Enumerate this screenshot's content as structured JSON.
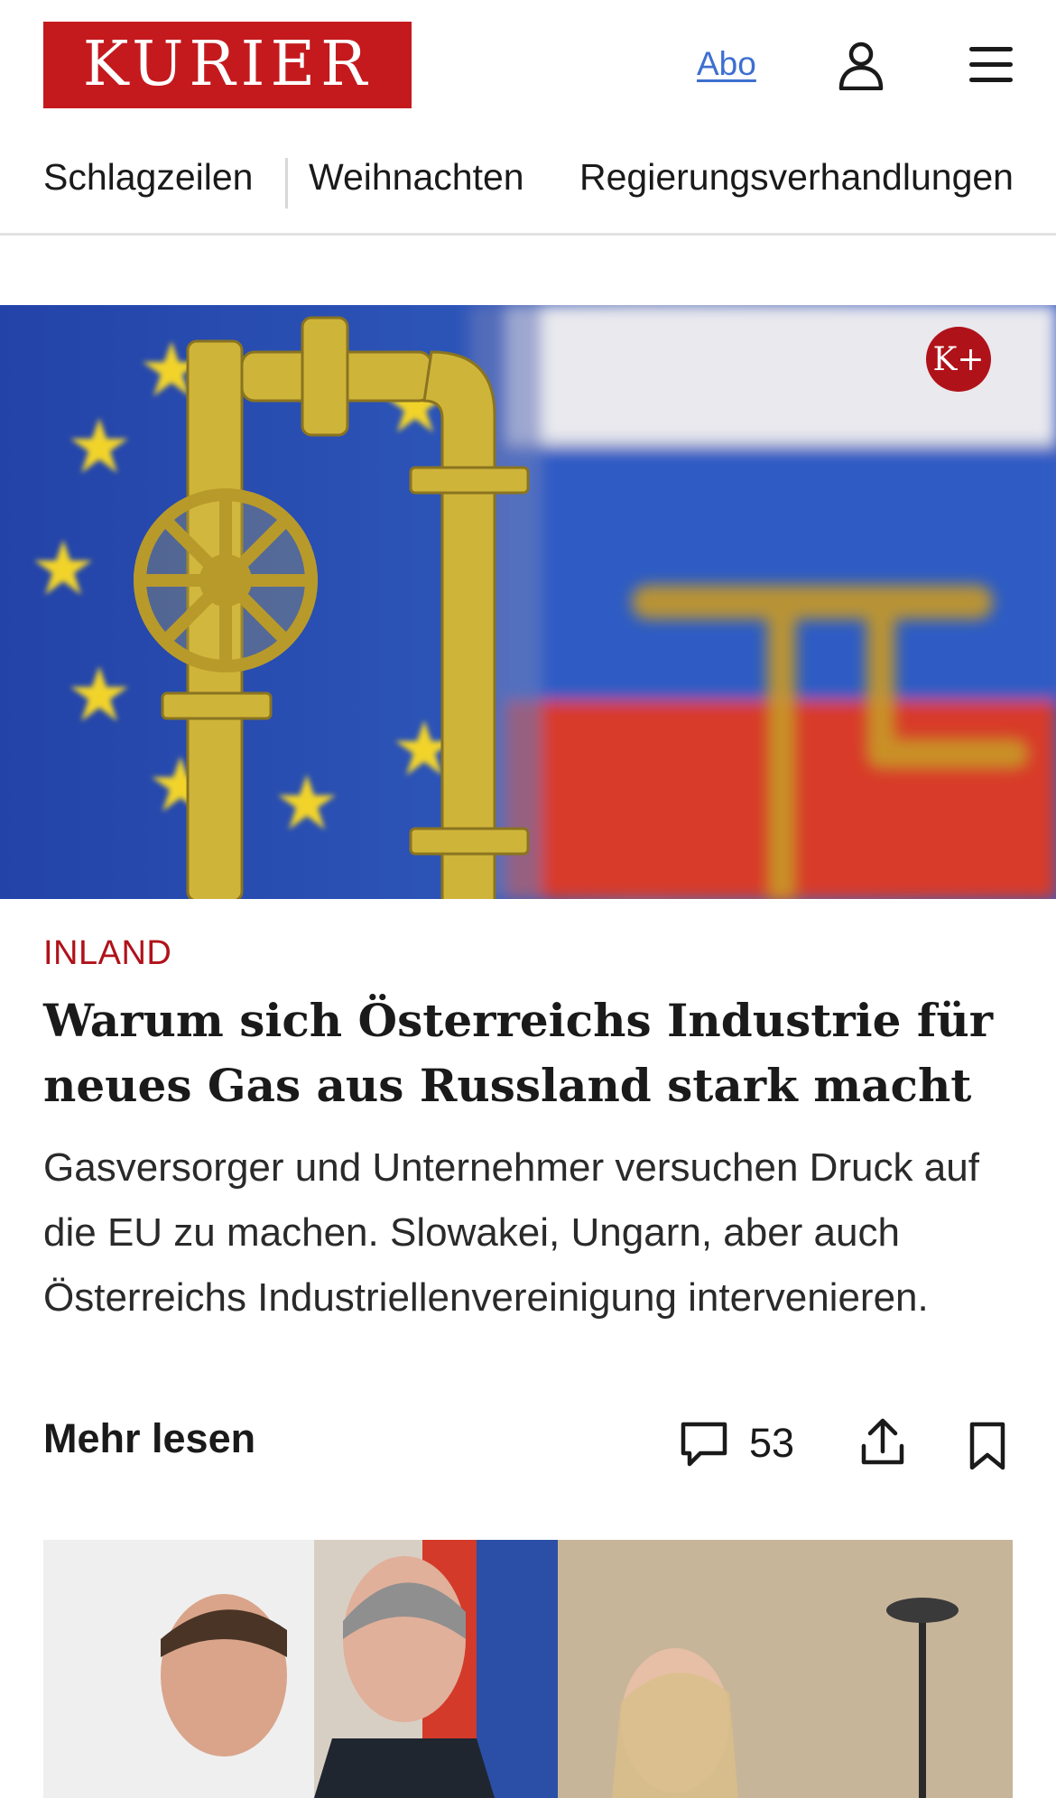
{
  "header": {
    "logo_text": "KURIER",
    "abo_label": "Abo",
    "user_icon": "user-icon",
    "menu_icon": "hamburger-menu-icon",
    "brand_color": "#c41a1e"
  },
  "nav": {
    "items": [
      "Schlagzeilen",
      "Weihnachten",
      "Regierungsverhandlungen"
    ]
  },
  "article": {
    "badge": "K+",
    "category": "INLAND",
    "title": "Warum sich Österreichs Industrie für neues Gas aus Russland stark macht",
    "teaser": "Gasversorger und Unternehmer versuchen Druck auf die EU zu machen. Slowakei, Ungarn, aber auch Österreichs Industriellenvereinigung intervenieren.",
    "more_label": "Mehr lesen",
    "comment_count": "53",
    "icons": [
      "comment-icon",
      "share-icon",
      "bookmark-icon"
    ],
    "accent_color": "#b0121a"
  }
}
